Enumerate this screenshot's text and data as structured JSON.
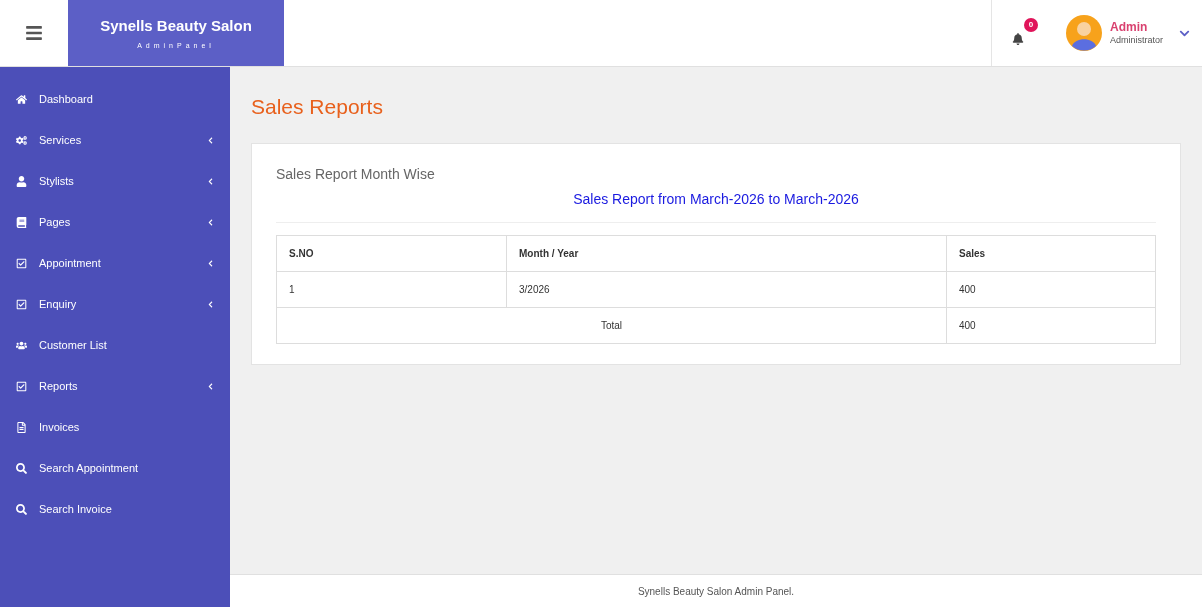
{
  "brand": {
    "title": "Synells Beauty Salon",
    "subtitle": "AdminPanel"
  },
  "header": {
    "notifications": "0",
    "user": {
      "name": "Admin",
      "role": "Administrator"
    }
  },
  "sidebar": {
    "items": [
      {
        "label": "Dashboard",
        "kind": "home",
        "has_submenu": false
      },
      {
        "label": "Services",
        "kind": "gears",
        "has_submenu": true
      },
      {
        "label": "Stylists",
        "kind": "user",
        "has_submenu": true
      },
      {
        "label": "Pages",
        "kind": "book",
        "has_submenu": true
      },
      {
        "label": "Appointment",
        "kind": "check",
        "has_submenu": true
      },
      {
        "label": "Enquiry",
        "kind": "check",
        "has_submenu": true
      },
      {
        "label": "Customer List",
        "kind": "users",
        "has_submenu": false
      },
      {
        "label": "Reports",
        "kind": "check",
        "has_submenu": true
      },
      {
        "label": "Invoices",
        "kind": "file",
        "has_submenu": false
      },
      {
        "label": "Search Appointment",
        "kind": "search",
        "has_submenu": false
      },
      {
        "label": "Search Invoice",
        "kind": "search",
        "has_submenu": false
      }
    ]
  },
  "page": {
    "title": "Sales Reports"
  },
  "card": {
    "title": "Sales Report Month Wise",
    "subtitle": "Sales Report from March-2026 to March-2026",
    "table": {
      "columns": [
        "S.NO",
        "Month / Year",
        "Sales"
      ],
      "rows": [
        {
          "cells": [
            "1",
            "3/2026",
            "400"
          ]
        }
      ],
      "total": {
        "label": "Total",
        "value": "400"
      }
    }
  },
  "footer": {
    "text": "Synells Beauty Salon Admin Panel."
  }
}
